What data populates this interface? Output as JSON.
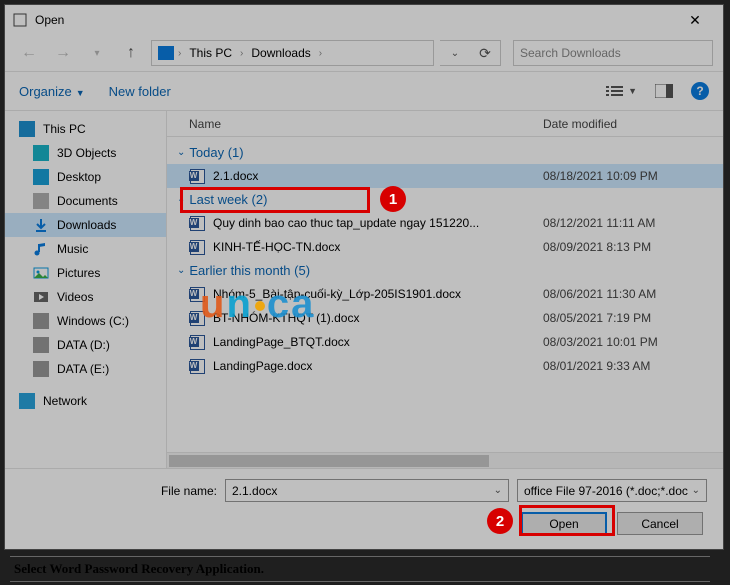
{
  "window": {
    "title": "Open"
  },
  "breadcrumbs": {
    "root": "This PC",
    "folder": "Downloads"
  },
  "search": {
    "placeholder": "Search Downloads"
  },
  "toolbar": {
    "organize": "Organize",
    "newfolder": "New folder"
  },
  "columns": {
    "name": "Name",
    "date": "Date modified"
  },
  "sidebar": {
    "items": [
      {
        "label": "This PC"
      },
      {
        "label": "3D Objects"
      },
      {
        "label": "Desktop"
      },
      {
        "label": "Documents"
      },
      {
        "label": "Downloads"
      },
      {
        "label": "Music"
      },
      {
        "label": "Pictures"
      },
      {
        "label": "Videos"
      },
      {
        "label": "Windows (C:)"
      },
      {
        "label": "DATA (D:)"
      },
      {
        "label": "DATA (E:)"
      },
      {
        "label": "Network"
      }
    ]
  },
  "groups": {
    "today": "Today (1)",
    "lastweek": "Last week (2)",
    "earlier": "Earlier this month (5)"
  },
  "files": {
    "today": [
      {
        "name": "2.1.docx",
        "date": "08/18/2021 10:09 PM"
      }
    ],
    "lastweek": [
      {
        "name": "Quy dinh bao cao thuc tap_update ngay 151220...",
        "date": "08/12/2021 11:11 AM"
      },
      {
        "name": "KINH-TẾ-HỌC-TN.docx",
        "date": "08/09/2021 8:13 PM"
      }
    ],
    "earlier": [
      {
        "name": "Nhóm-5_Bài-tập-cuối-kỳ_Lớp-205IS1901.docx",
        "date": "08/06/2021 11:30 AM"
      },
      {
        "name": "BT-NHÓM-KTHQT (1).docx",
        "date": "08/05/2021 7:19 PM"
      },
      {
        "name": "LandingPage_BTQT.docx",
        "date": "08/03/2021 10:01 PM"
      },
      {
        "name": "LandingPage.docx",
        "date": "08/01/2021 9:33 AM"
      }
    ]
  },
  "filename": {
    "label": "File name:",
    "value": "2.1.docx"
  },
  "filter": {
    "value": "office File 97-2016 (*.doc;*.doc"
  },
  "buttons": {
    "open": "Open",
    "cancel": "Cancel"
  },
  "caption": "Select Word Password Recovery Application."
}
